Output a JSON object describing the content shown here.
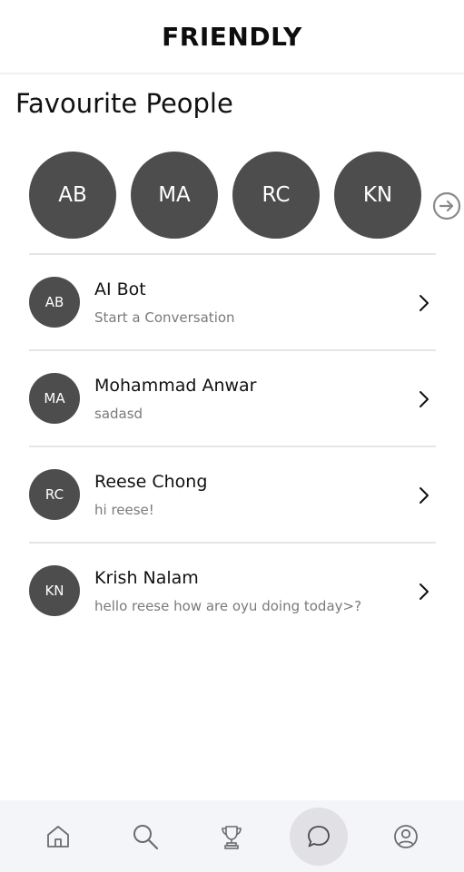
{
  "header": {
    "title": "FRIENDLY"
  },
  "favourites": {
    "title": "Favourite People",
    "people": [
      {
        "initials": "AB"
      },
      {
        "initials": "MA"
      },
      {
        "initials": "RC"
      },
      {
        "initials": "KN"
      }
    ],
    "next_icon": "arrow-right-circle-icon"
  },
  "conversations": [
    {
      "initials": "AB",
      "name": "AI Bot",
      "last_message": "Start a Conversation"
    },
    {
      "initials": "MA",
      "name": "Mohammad Anwar",
      "last_message": "sadasd"
    },
    {
      "initials": "RC",
      "name": "Reese Chong",
      "last_message": "hi reese!"
    },
    {
      "initials": "KN",
      "name": "Krish Nalam",
      "last_message": "hello reese how are oyu doing today>?"
    }
  ],
  "bottom_nav": {
    "items": [
      {
        "icon": "home-icon"
      },
      {
        "icon": "search-icon"
      },
      {
        "icon": "trophy-icon"
      },
      {
        "icon": "chat-bubble-icon",
        "active": true
      },
      {
        "icon": "profile-icon"
      }
    ]
  },
  "colors": {
    "avatar_bg": "#4d4d4d",
    "nav_bg": "#f4f5f8",
    "active_nav_bg": "#e1e1e5",
    "secondary_text": "#7a7a7a"
  }
}
